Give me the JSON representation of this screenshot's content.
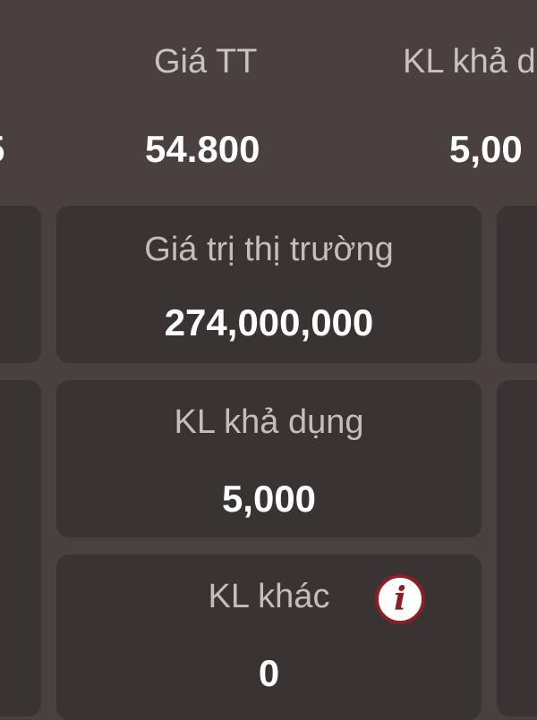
{
  "header": {
    "left_value_partial": "5",
    "price_label": "Giá TT",
    "price_value": "54.800",
    "avail_label_partial": "KL khả d",
    "avail_value_partial": "5,00"
  },
  "cards": {
    "market_value": {
      "label": "Giá trị thị trường",
      "value": "274,000,000"
    },
    "available_qty": {
      "label": "KL khả dụng",
      "value": "5,000"
    },
    "other_qty": {
      "label": "KL khác",
      "value": "0",
      "icon": "info-icon"
    }
  },
  "colors": {
    "background": "#4a4040",
    "card": "#3a3333",
    "info_accent": "#8a1f25"
  }
}
